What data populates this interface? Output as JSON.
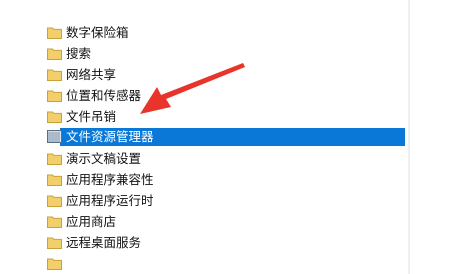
{
  "tree": {
    "items": [
      {
        "label": "数字保险箱",
        "icon": "folder-icon",
        "selected": false
      },
      {
        "label": "搜索",
        "icon": "folder-icon",
        "selected": false
      },
      {
        "label": "网络共享",
        "icon": "folder-icon",
        "selected": false
      },
      {
        "label": "位置和传感器",
        "icon": "folder-icon",
        "selected": false
      },
      {
        "label": "文件吊销",
        "icon": "folder-icon",
        "selected": false
      },
      {
        "label": "文件资源管理器",
        "icon": "policy-icon",
        "selected": true
      },
      {
        "label": "演示文稿设置",
        "icon": "folder-icon",
        "selected": false
      },
      {
        "label": "应用程序兼容性",
        "icon": "folder-icon",
        "selected": false
      },
      {
        "label": "应用程序运行时",
        "icon": "folder-icon",
        "selected": false
      },
      {
        "label": "应用商店",
        "icon": "folder-icon",
        "selected": false
      },
      {
        "label": "远程桌面服务",
        "icon": "folder-icon",
        "selected": false
      }
    ]
  },
  "colors": {
    "selection": "#0a78d7",
    "arrow": "#e8342b",
    "folder": "#f3cf6b"
  }
}
